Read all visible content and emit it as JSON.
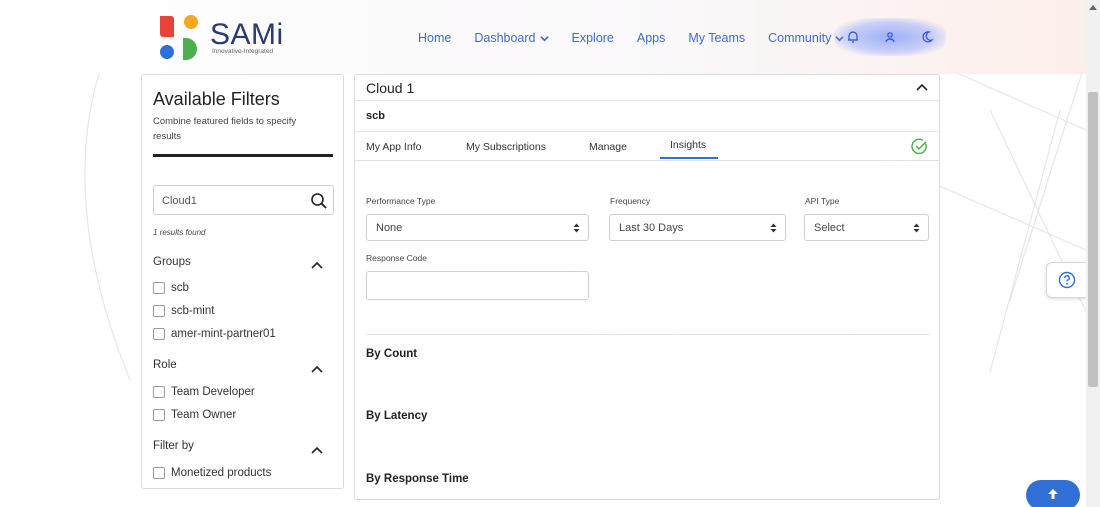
{
  "header": {
    "brand": "SAMi",
    "tagline": "Innovative-Integrated",
    "nav": [
      {
        "label": "Home",
        "dropdown": false
      },
      {
        "label": "Dashboard",
        "dropdown": true
      },
      {
        "label": "Explore",
        "dropdown": false
      },
      {
        "label": "Apps",
        "dropdown": false
      },
      {
        "label": "My Teams",
        "dropdown": false
      },
      {
        "label": "Community",
        "dropdown": true
      }
    ],
    "icons": [
      "bell-icon",
      "user-icon",
      "moon-icon"
    ]
  },
  "filters": {
    "title": "Available Filters",
    "subtitle": "Combine featured fields to specify results",
    "search_value": "Cloud1",
    "results_text": "1 results found",
    "groups": {
      "label": "Groups",
      "items": [
        "scb",
        "scb-mint",
        "amer-mint-partner01"
      ]
    },
    "role": {
      "label": "Role",
      "items": [
        "Team Developer",
        "Team Owner"
      ]
    },
    "filter_by": {
      "label": "Filter by",
      "items": [
        "Monetized products"
      ]
    }
  },
  "main": {
    "title": "Cloud 1",
    "org": "scb",
    "tabs": [
      "My App Info",
      "My Subscriptions",
      "Manage",
      "Insights"
    ],
    "active_tab": "Insights",
    "fields": {
      "performance_type": {
        "label": "Performance Type",
        "value": "None"
      },
      "frequency": {
        "label": "Frequency",
        "value": "Last 30 Days"
      },
      "api_type": {
        "label": "API Type",
        "value": "Select"
      },
      "response_code": {
        "label": "Response Code",
        "value": ""
      }
    },
    "sections": [
      "By Count",
      "By Latency",
      "By Response Time"
    ]
  },
  "colors": {
    "accent": "#2f6fd6",
    "nav_link": "#3d6cc6",
    "brand_text": "#2b3a73",
    "success": "#4caf50",
    "logo_red": "#e8423b",
    "logo_orange": "#f5a623",
    "logo_blue": "#2f6fd6",
    "logo_green": "#4caf50"
  }
}
